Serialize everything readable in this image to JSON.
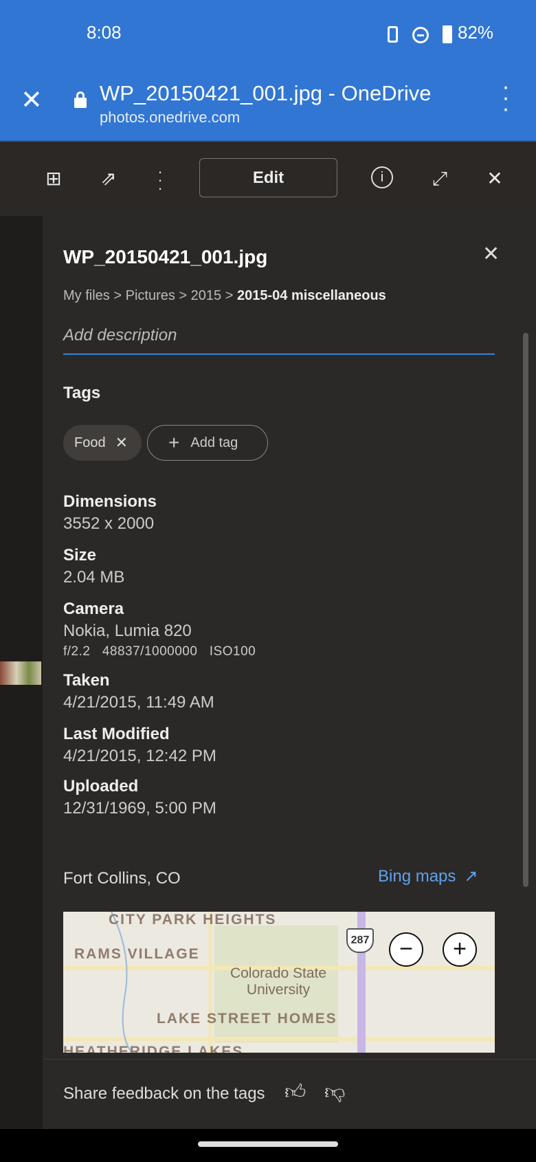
{
  "status": {
    "time": "8:08",
    "battery": "82%",
    "icons": [
      "phone-icon",
      "do-not-disturb-icon",
      "battery-icon"
    ]
  },
  "browser": {
    "title": "WP_20150421_001.jpg - OneDrive",
    "url": "photos.onedrive.com"
  },
  "toolbar": {
    "edit_label": "Edit"
  },
  "panel": {
    "filename": "WP_20150421_001.jpg",
    "breadcrumb": [
      "My files",
      "Pictures",
      "2015",
      "2015-04 miscellaneous"
    ],
    "breadcrumb_sep": ">",
    "description_placeholder": "Add description",
    "tags_label": "Tags",
    "tags": [
      "Food"
    ],
    "add_tag": "Add tag",
    "dimensions_label": "Dimensions",
    "dimensions": "3552 x 2000",
    "size_label": "Size",
    "size": "2.04 MB",
    "camera_label": "Camera",
    "camera": "Nokia, Lumia 820",
    "exif": {
      "aperture": "f/2.2",
      "exposure": "48837/1000000",
      "iso": "ISO100"
    },
    "taken_label": "Taken",
    "taken": "4/21/2015, 11:49 AM",
    "modified_label": "Last Modified",
    "modified": "4/21/2015, 12:42 PM",
    "uploaded_label": "Uploaded",
    "uploaded": "12/31/1969, 5:00 PM",
    "location": "Fort Collins, CO",
    "bing_maps": "Bing maps",
    "accent": "#5ea1ee"
  },
  "map": {
    "labels": [
      "CITY PARK HEIGHTS",
      "RAMS VILLAGE",
      "Colorado State University",
      "LAKE STREET HOMES",
      "HEATHERIDGE LAKES",
      "287"
    ]
  },
  "feedback": {
    "text": "Share feedback on the tags"
  }
}
